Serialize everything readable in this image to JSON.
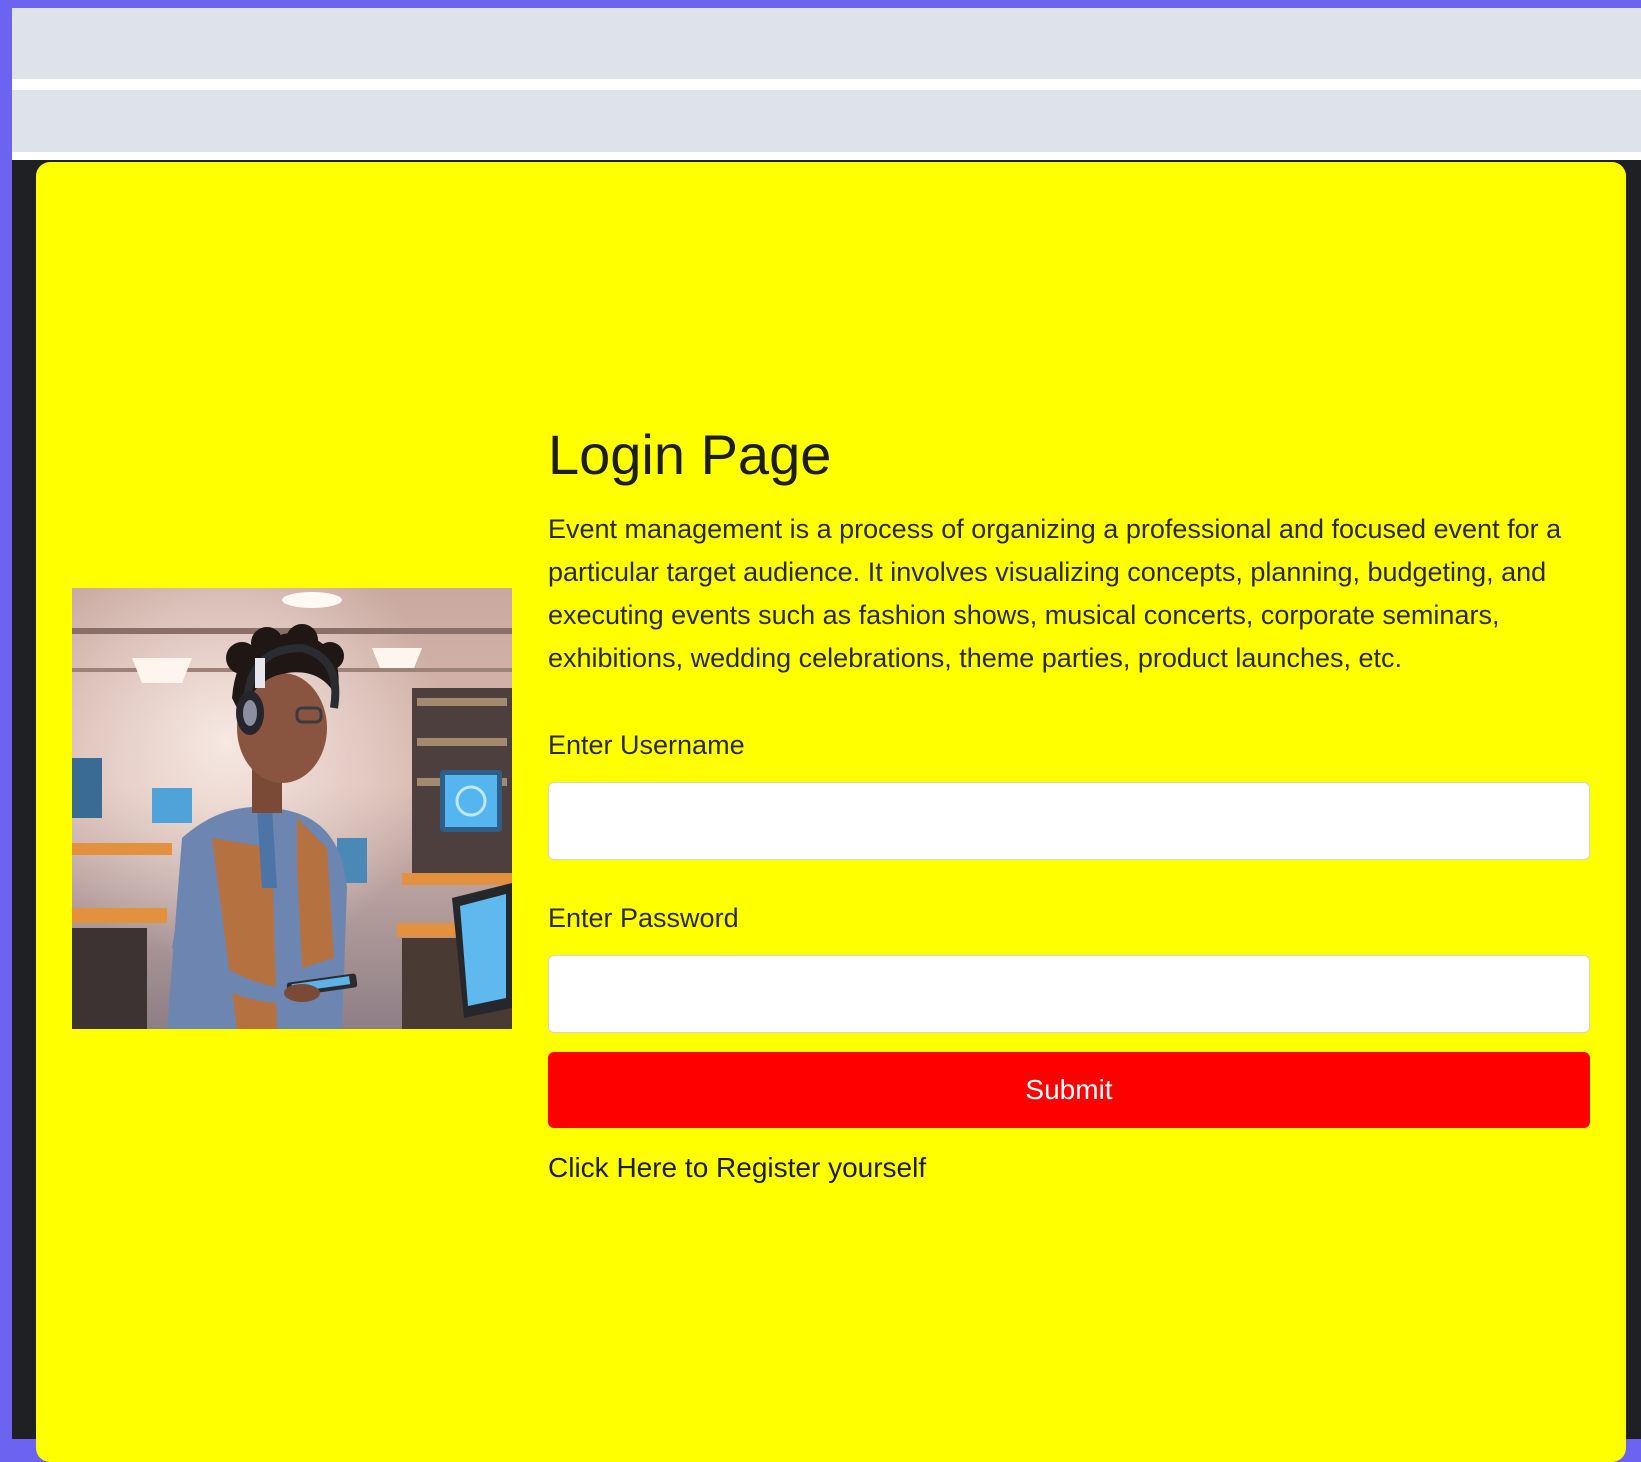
{
  "page": {
    "title": "Login Page",
    "description": "Event management is a process of organizing a professional and focused event for a particular target audience. It involves visualizing concepts, planning, budgeting, and executing events such as fashion shows, musical concerts, corporate seminars, exhibitions, wedding celebrations, theme parties, product launches, etc."
  },
  "form": {
    "username_label": "Enter Username",
    "username_value": "",
    "password_label": "Enter Password",
    "password_value": "",
    "submit_label": "Submit",
    "register_link": "Click Here to Register yourself"
  },
  "colors": {
    "page_background": "#6c63f0",
    "card_background": "#ffff00",
    "submit_background": "#ff0000",
    "submit_text": "#ffffff"
  }
}
